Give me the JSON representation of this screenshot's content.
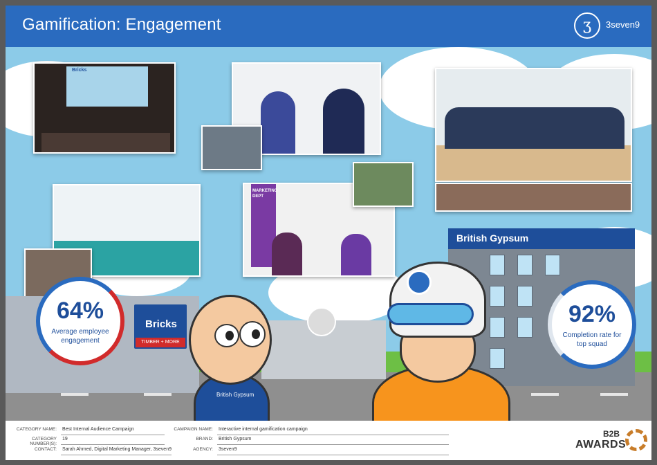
{
  "header": {
    "title": "Gamification: Engagement",
    "logo_mark": "ʒ",
    "logo_text": "3seven9"
  },
  "photos": {
    "presentation_screen_label": "Bricks",
    "marketing_sign": "MARKETING DEPT"
  },
  "buildings": {
    "right_sign": "British Gypsum",
    "left_sign": "Bricks",
    "left_sign_sub": "TIMBER + MORE"
  },
  "characters": {
    "left_shirt_mark": "British Gypsum"
  },
  "stats": {
    "left": {
      "value": "64%",
      "label": "Average employee engagement"
    },
    "right": {
      "value": "92%",
      "label": "Completion rate for top squad"
    }
  },
  "footer": {
    "category_name_key": "CATEGORY NAME:",
    "category_name": "Best Internal Audience Campaign",
    "category_number_key": "CATEGORY NUMBER(S):",
    "category_number": "19",
    "contact_key": "CONTACT:",
    "contact": "Sarah Ahmed, Digital Marketing Manager, 3seven9",
    "campaign_name_key": "CAMPAIGN NAME:",
    "campaign_name": "Interactive internal gamification campaign",
    "brand_key": "BRAND:",
    "brand": "British Gypsum",
    "agency_key": "AGENCY:",
    "agency": "3seven9"
  },
  "awards": {
    "b2b": "B2B",
    "word": "AWARDS"
  },
  "colors": {
    "header_blue": "#2a6bbf",
    "brand_blue": "#1e4e9a",
    "accent_red": "#d12b2b",
    "sky": "#8ccbe8"
  }
}
